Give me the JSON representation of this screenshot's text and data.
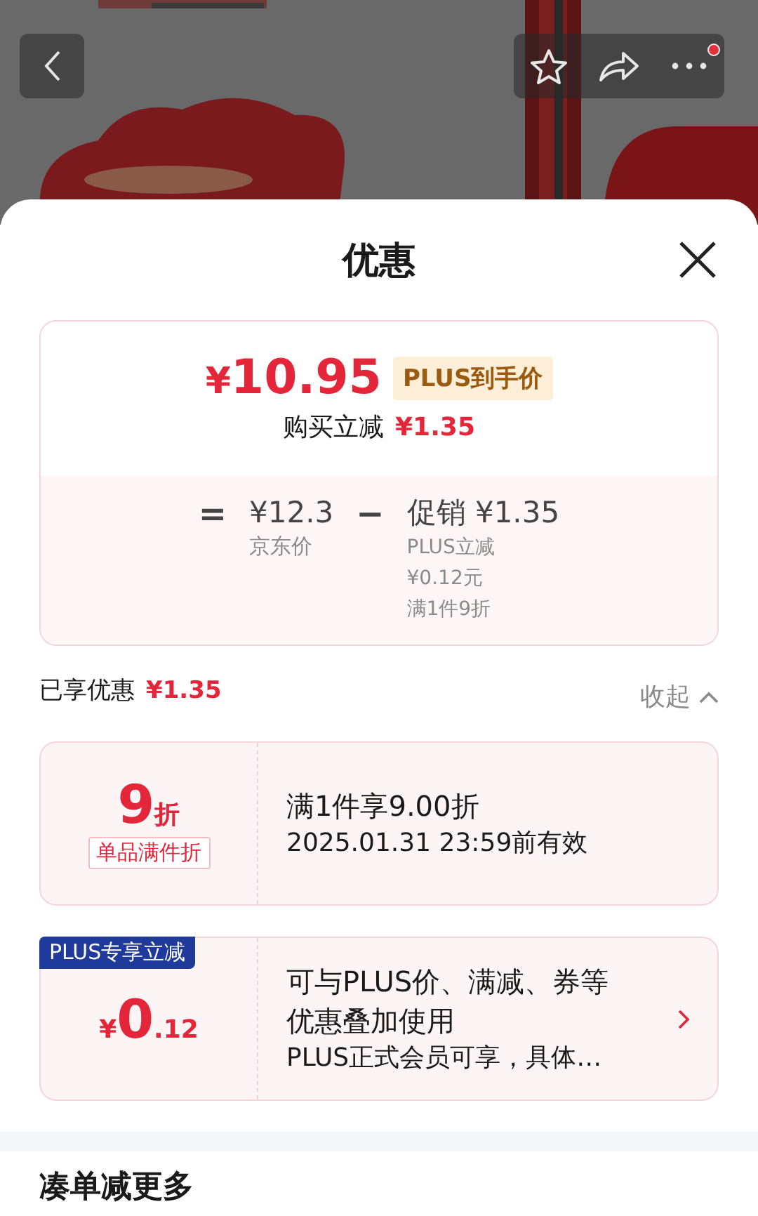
{
  "nav": {
    "buttons": [
      {
        "kind": "back"
      },
      {
        "kind": "star"
      },
      {
        "kind": "share"
      },
      {
        "kind": "more",
        "has_notification": true
      }
    ]
  },
  "sheet": {
    "title": "优惠"
  },
  "summary": {
    "price_symbol": "¥",
    "price": "10.95",
    "price_tag": "PLUS到手价",
    "reduce_label": "购买立减",
    "reduce_amount": "¥1.35",
    "breakdown": {
      "equals": "=",
      "base_price": "¥12.3",
      "base_label": "京东价",
      "minus": "−",
      "promo_label": "促销",
      "promo_amount": "¥1.35",
      "promo_details": [
        "PLUS立减",
        "¥0.12元",
        "满1件9折"
      ]
    }
  },
  "enjoyed": {
    "label": "已享优惠",
    "amount": "¥1.35",
    "toggle": "收起",
    "expanded": true
  },
  "coupons": [
    {
      "kind": "discount",
      "value": "9",
      "unit": "折",
      "tag": "单品满件折",
      "lines": [
        "满1件享9.00折",
        "2025.01.31 23:59前有效"
      ]
    },
    {
      "kind": "plus",
      "ribbon": "PLUS专享立减",
      "symbol": "¥",
      "value": "0",
      "decimal": ".12",
      "lines": [
        "可与PLUS价、满减、券等优惠叠加使用",
        "PLUS正式会员可享，具体…"
      ],
      "has_arrow": true
    }
  ],
  "section": {
    "title": "凑单减更多"
  }
}
